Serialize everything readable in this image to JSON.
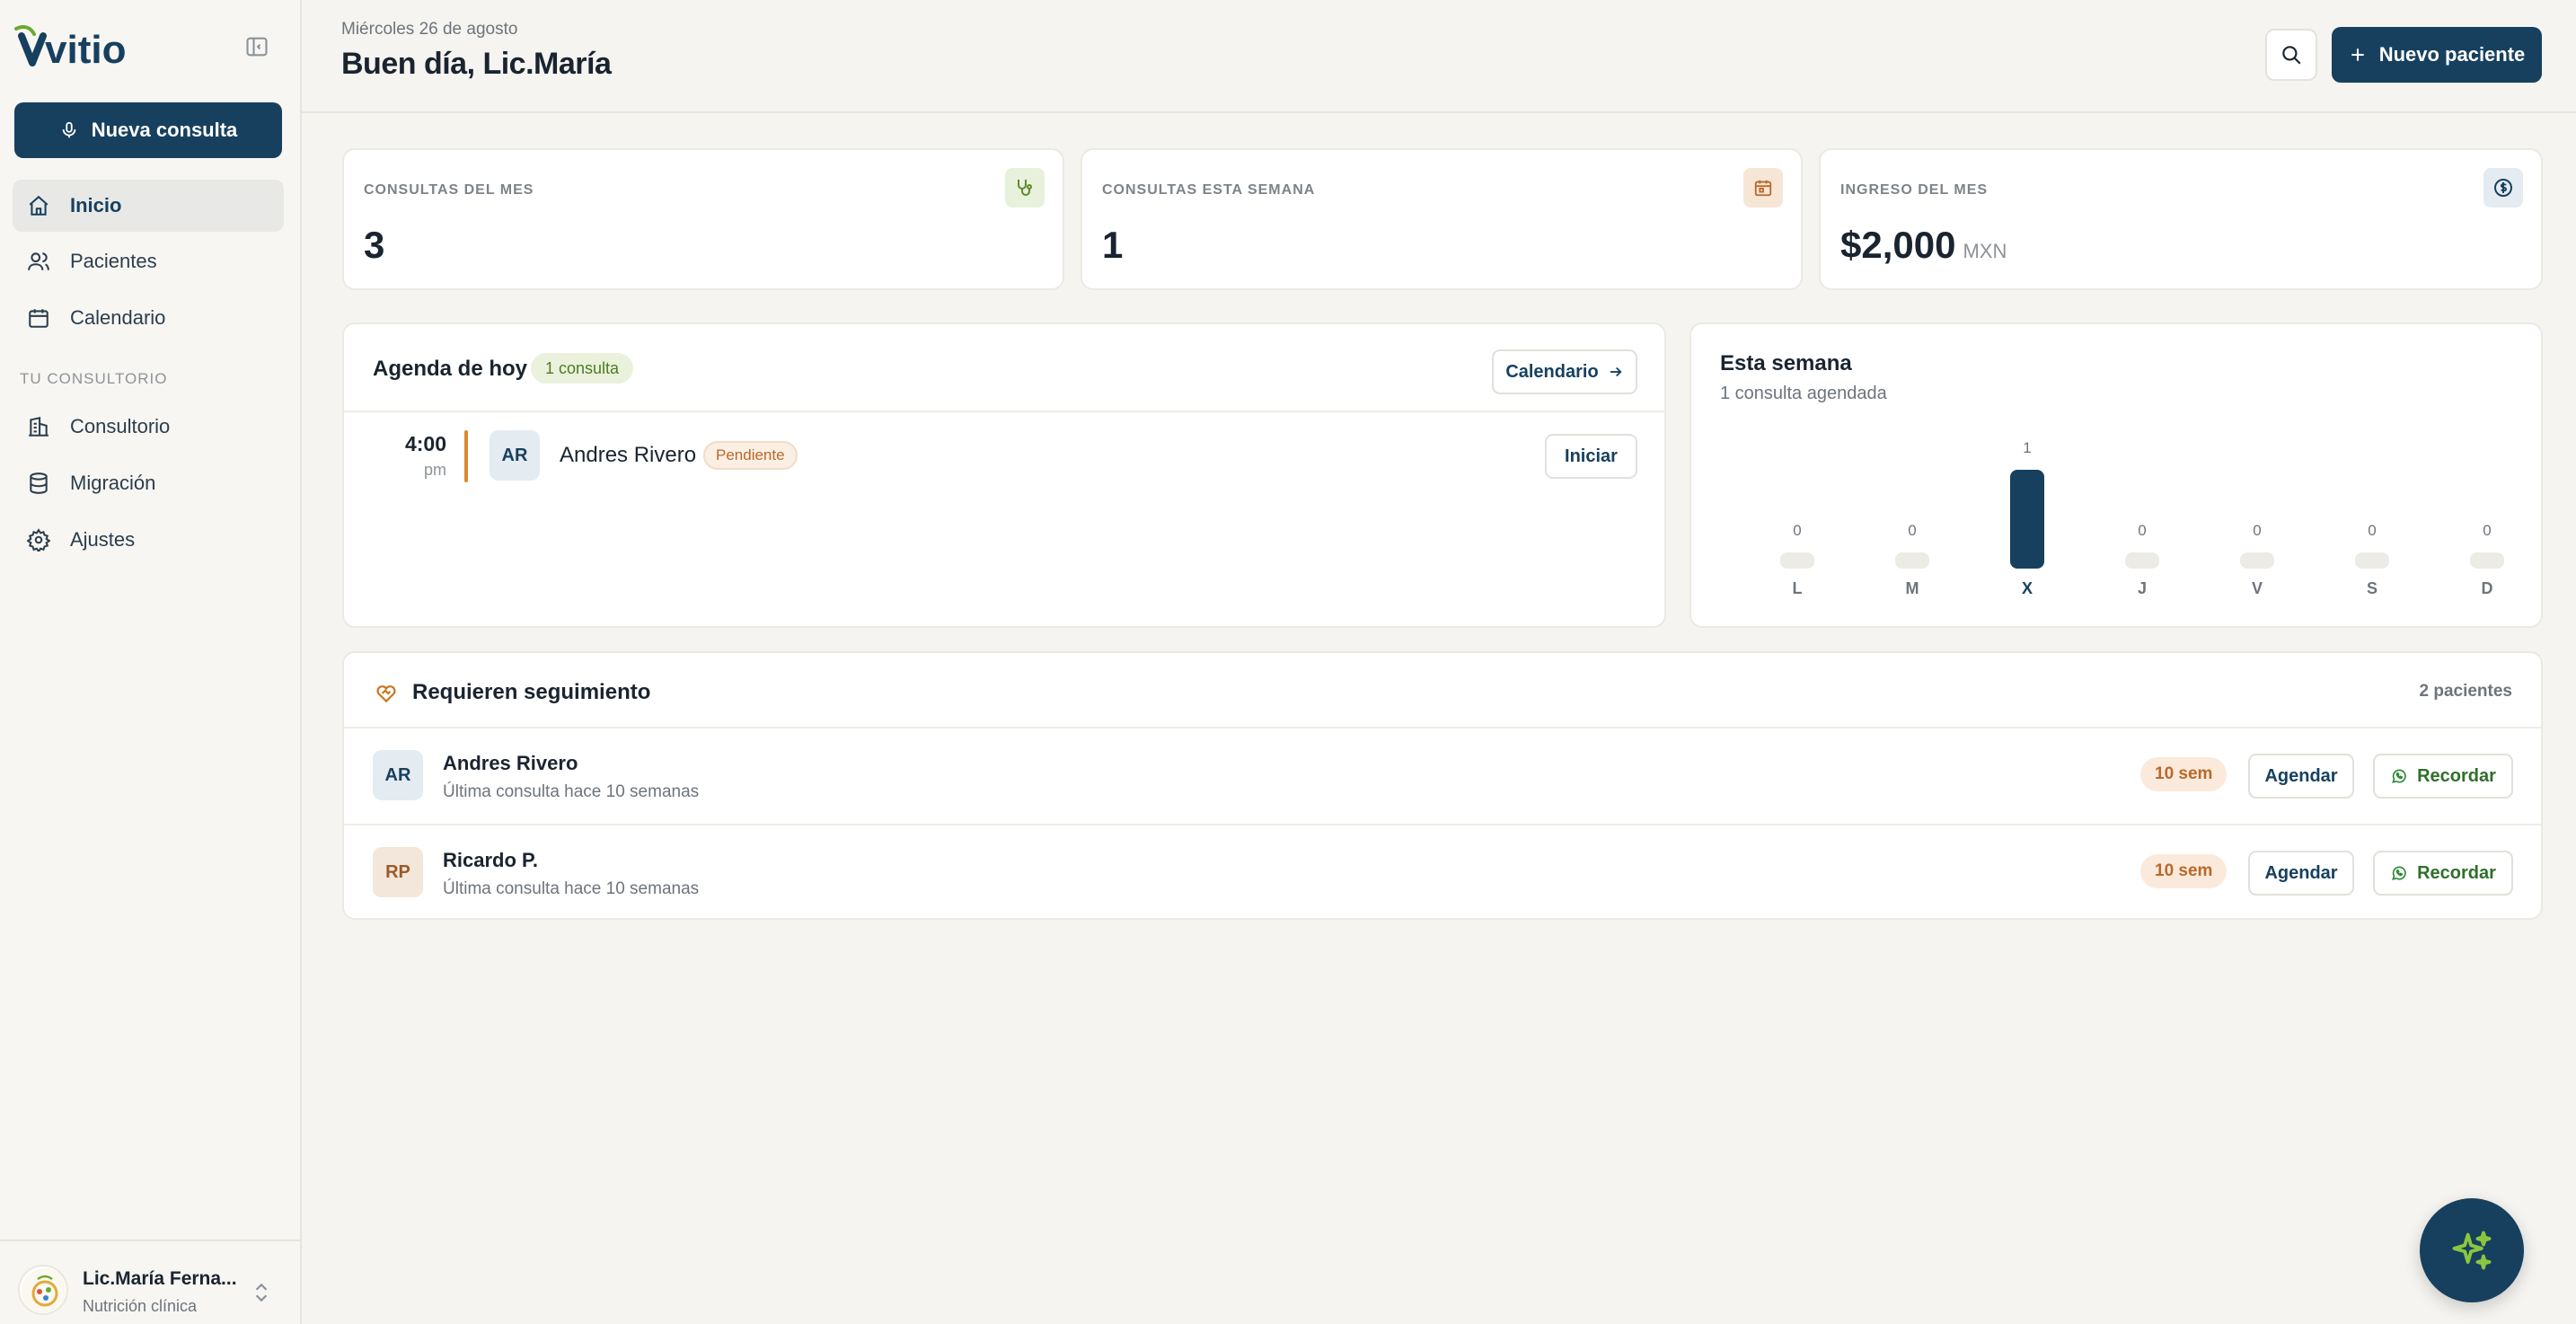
{
  "sidebar": {
    "logo_text": "vitio",
    "new_consult_label": "Nueva consulta",
    "nav": [
      {
        "label": "Inicio",
        "icon": "home-icon"
      },
      {
        "label": "Pacientes",
        "icon": "users-icon"
      },
      {
        "label": "Calendario",
        "icon": "calendar-icon"
      }
    ],
    "section_label": "TU CONSULTORIO",
    "section_nav": [
      {
        "label": "Consultorio",
        "icon": "building-icon"
      },
      {
        "label": "Migración",
        "icon": "database-icon"
      },
      {
        "label": "Ajustes",
        "icon": "gear-icon"
      }
    ],
    "user": {
      "name": "Lic.María Ferna...",
      "role": "Nutrición clínica"
    }
  },
  "header": {
    "date": "Miércoles 26 de agosto",
    "greeting": "Buen día, Lic.María",
    "new_patient_label": "Nuevo paciente"
  },
  "stats": [
    {
      "label": "CONSULTAS DEL MES",
      "value": "3",
      "unit": "",
      "icon": "stethoscope-icon",
      "icon_bg": "#e7f1dc",
      "icon_color": "#5f8a2e"
    },
    {
      "label": "CONSULTAS ESTA SEMANA",
      "value": "1",
      "unit": "",
      "icon": "calendar-icon",
      "icon_bg": "#f6e6d6",
      "icon_color": "#b8692a"
    },
    {
      "label": "INGRESO DEL MES",
      "value": "$2,000",
      "unit": "MXN",
      "icon": "dollar-icon",
      "icon_bg": "#e4ebf1",
      "icon_color": "#17405f"
    }
  ],
  "agenda": {
    "title": "Agenda de hoy",
    "badge": "1 consulta",
    "calendar_link": "Calendario",
    "items": [
      {
        "time": "4:00",
        "ampm": "pm",
        "initials": "AR",
        "name": "Andres Rivero",
        "status": "Pendiente",
        "action": "Iniciar"
      }
    ]
  },
  "week": {
    "title": "Esta semana",
    "subtitle": "1 consulta agendada"
  },
  "chart_data": {
    "type": "bar",
    "categories": [
      "L",
      "M",
      "X",
      "J",
      "V",
      "S",
      "D"
    ],
    "values": [
      0,
      0,
      1,
      0,
      0,
      0,
      0
    ],
    "highlight": "X",
    "title": "Esta semana",
    "colors": {
      "active": "#17405f",
      "empty": "#ecebe6"
    }
  },
  "followup": {
    "title": "Requieren seguimiento",
    "count": "2 pacientes",
    "rows": [
      {
        "initials": "AR",
        "name": "Andres Rivero",
        "last": "Última consulta hace 10 semanas",
        "weeks": "10 sem",
        "schedule": "Agendar",
        "remind": "Recordar",
        "avatar_bg": "#e4ebf1",
        "avatar_color": "#17405f"
      },
      {
        "initials": "RP",
        "name": "Ricardo P.",
        "last": "Última consulta hace 10 semanas",
        "weeks": "10 sem",
        "schedule": "Agendar",
        "remind": "Recordar",
        "avatar_bg": "#f3e6da",
        "avatar_color": "#9a5a2a"
      }
    ]
  },
  "colors": {
    "brand": "#17405f",
    "accent_green": "#5a9a2a",
    "accent_orange": "#c8741e"
  }
}
